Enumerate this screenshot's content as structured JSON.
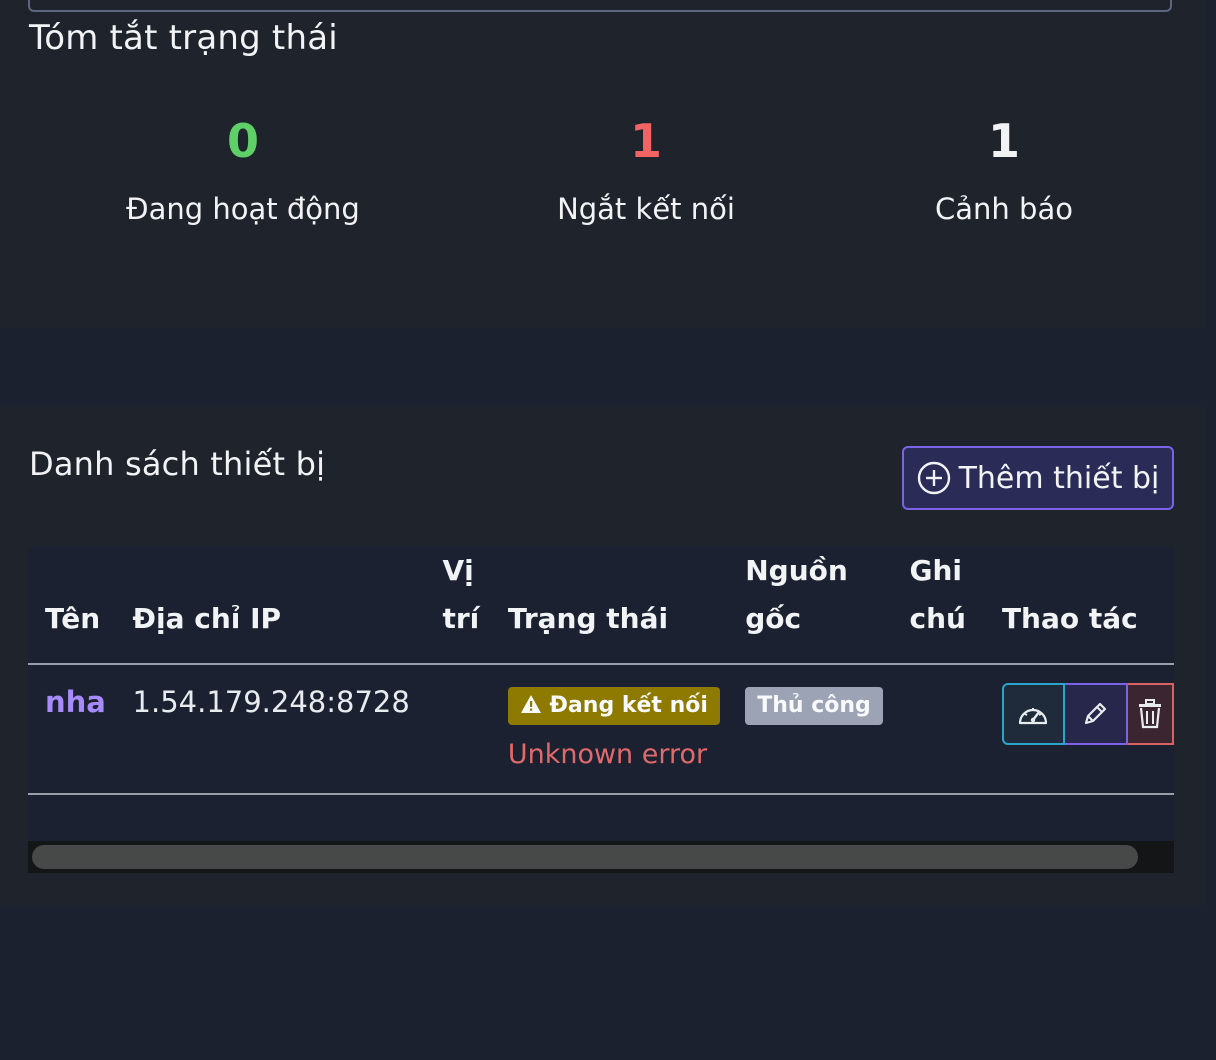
{
  "summary": {
    "title": "Tóm tắt trạng thái",
    "items": [
      {
        "count": "0",
        "label": "Đang hoạt động",
        "color": "#5fd068"
      },
      {
        "count": "1",
        "label": "Ngắt kết nối",
        "color": "#f26464"
      },
      {
        "count": "1",
        "label": "Cảnh báo",
        "color": "#f1f3f5"
      }
    ]
  },
  "devices": {
    "title": "Danh sách thiết bị",
    "add_button_label": "Thêm thiết bị",
    "add_button_icon": "plus-circle-icon",
    "columns": {
      "name": "Tên",
      "ip": "Địa chỉ IP",
      "location": "Vị trí",
      "status": "Trạng thái",
      "source": "Nguồn gốc",
      "notes": "Ghi chú",
      "actions": "Thao tác"
    },
    "rows": [
      {
        "name": "nha",
        "ip": "1.54.179.248:8728",
        "location": "",
        "status_badge": "Đang kết nối",
        "status_icon": "warning-triangle-icon",
        "status_error": "Unknown error",
        "source": "Thủ công",
        "notes": "",
        "action_icons": [
          "gauge-icon",
          "pencil-icon",
          "trash-icon"
        ]
      }
    ]
  },
  "colors": {
    "page_bg": "#1c2130",
    "card_bg": "#1f232c",
    "accent": "#7a63e6",
    "active": "#5fd068",
    "disconnected": "#f26464",
    "warning_badge": "#8e7a00",
    "source_badge": "#9ca3b4"
  }
}
